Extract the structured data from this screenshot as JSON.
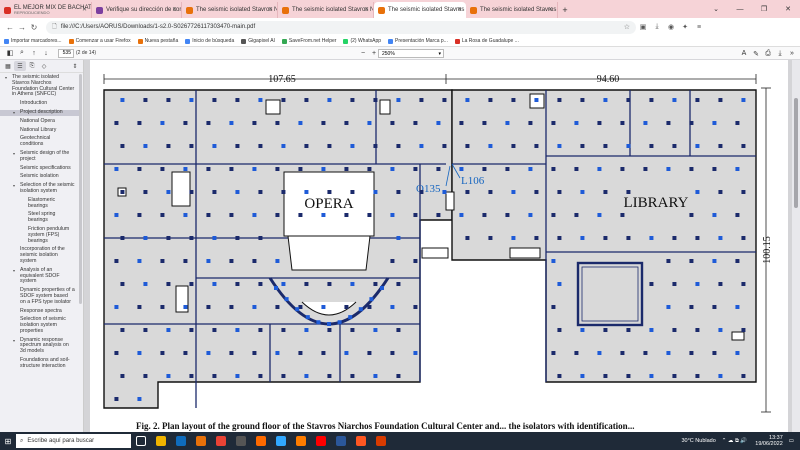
{
  "browser": {
    "tabs": [
      {
        "title": "EL MEJOR MIX DE BACHATA - F",
        "subtitle": "REPRODUCIENDO",
        "color": "#d93025",
        "active": false
      },
      {
        "title": "Verifique su dirección de corre",
        "subtitle": "",
        "color": "#7b3fa0",
        "active": false
      },
      {
        "title": "The seismic isolated Stavros N",
        "subtitle": "",
        "color": "#e8710a",
        "active": false
      },
      {
        "title": "The seismic isolated Stavros N",
        "subtitle": "",
        "color": "#e8710a",
        "active": false
      },
      {
        "title": "The seismic isolated Stavros N",
        "subtitle": "",
        "color": "#e8710a",
        "active": true
      },
      {
        "title": "The seismic isolated Stavros N",
        "subtitle": "",
        "color": "#e8710a",
        "active": false
      }
    ],
    "new_tab": "+",
    "address": "file:///C:/Users/AORUS/Downloads/1-s2.0-S0267726117303470-main.pdf",
    "bookmarks": [
      {
        "label": "Importar marcadores...",
        "color": "#4285f4"
      },
      {
        "label": "Comenzar a usar Firefox",
        "color": "#e8710a"
      },
      {
        "label": "Nueva pestaña",
        "color": "#e8710a"
      },
      {
        "label": "Inicio de búsqueda",
        "color": "#4285f4"
      },
      {
        "label": "Gigapixel AI",
        "color": "#555555"
      },
      {
        "label": "SaveFrom.net Helper",
        "color": "#34a853"
      },
      {
        "label": "(2) WhatsApp",
        "color": "#25d366"
      },
      {
        "label": "Presentación Marca p...",
        "color": "#4285f4"
      },
      {
        "label": "La Rosa de Guadalupe ...",
        "color": "#d93025"
      }
    ]
  },
  "pdf": {
    "page_current": "535",
    "page_count": "(2 de 14)",
    "zoom": "250%",
    "plan": {
      "dim_left": "107.65",
      "dim_right": "94.60",
      "dim_side": "100.15",
      "opera_label": "OPERA",
      "library_label": "LIBRARY",
      "isolator_a": "O135",
      "isolator_b": "L106"
    },
    "caption": "Fig. 2. Plan layout of the ground floor of the Stavros Niarchos Foundation Cultural Center and... the isolators with identification..."
  },
  "outline": [
    {
      "text": "The seismic isolated Stavros Niarchos Foundation Cultural Center in Athens (SNFCC)",
      "level": 0,
      "twisty": "▾"
    },
    {
      "text": "Introduction",
      "level": 1,
      "twisty": ""
    },
    {
      "text": "Project description",
      "level": 1,
      "twisty": "▾",
      "selected": true
    },
    {
      "text": "National Opera",
      "level": 2,
      "twisty": ""
    },
    {
      "text": "National Library",
      "level": 2,
      "twisty": ""
    },
    {
      "text": "Geotechnical conditions",
      "level": 2,
      "twisty": ""
    },
    {
      "text": "Seismic design of the project",
      "level": 1,
      "twisty": "▾"
    },
    {
      "text": "Seismic specifications",
      "level": 2,
      "twisty": ""
    },
    {
      "text": "Seismic isolation",
      "level": 2,
      "twisty": ""
    },
    {
      "text": "Selection of the seismic isolation system",
      "level": 2,
      "twisty": "▾"
    },
    {
      "text": "Elastomeric bearings",
      "level": 3,
      "twisty": ""
    },
    {
      "text": "Steel spring bearings",
      "level": 3,
      "twisty": ""
    },
    {
      "text": "Friction pendulum system (FPS) bearings",
      "level": 3,
      "twisty": ""
    },
    {
      "text": "Incorporation of the seismic isolation system",
      "level": 2,
      "twisty": ""
    },
    {
      "text": "Analysis of an equivalent SDOF system",
      "level": 1,
      "twisty": "▾"
    },
    {
      "text": "Dynamic properties of a SDOF system based on a FPS type isolator",
      "level": 2,
      "twisty": ""
    },
    {
      "text": "Response spectra",
      "level": 2,
      "twisty": ""
    },
    {
      "text": "Selection of seismic isolation system properties",
      "level": 2,
      "twisty": ""
    },
    {
      "text": "Dynamic response spectrum analysis on 3d models",
      "level": 1,
      "twisty": "▾"
    },
    {
      "text": "Foundations and soil-structure interaction",
      "level": 2,
      "twisty": ""
    }
  ],
  "taskbar": {
    "search_placeholder": "Escribe aquí para buscar",
    "apps": [
      "#f0b400",
      "#0f6cbd",
      "#e8710a",
      "#ea4335",
      "#555555",
      "#ff6a00",
      "#31a8ff",
      "#ff7c00",
      "#ff0000",
      "#2b579a",
      "#ff5722",
      "#d83b01"
    ],
    "weather": "30°C  Nublado",
    "time": "13:37",
    "date": "19/06/2022"
  }
}
